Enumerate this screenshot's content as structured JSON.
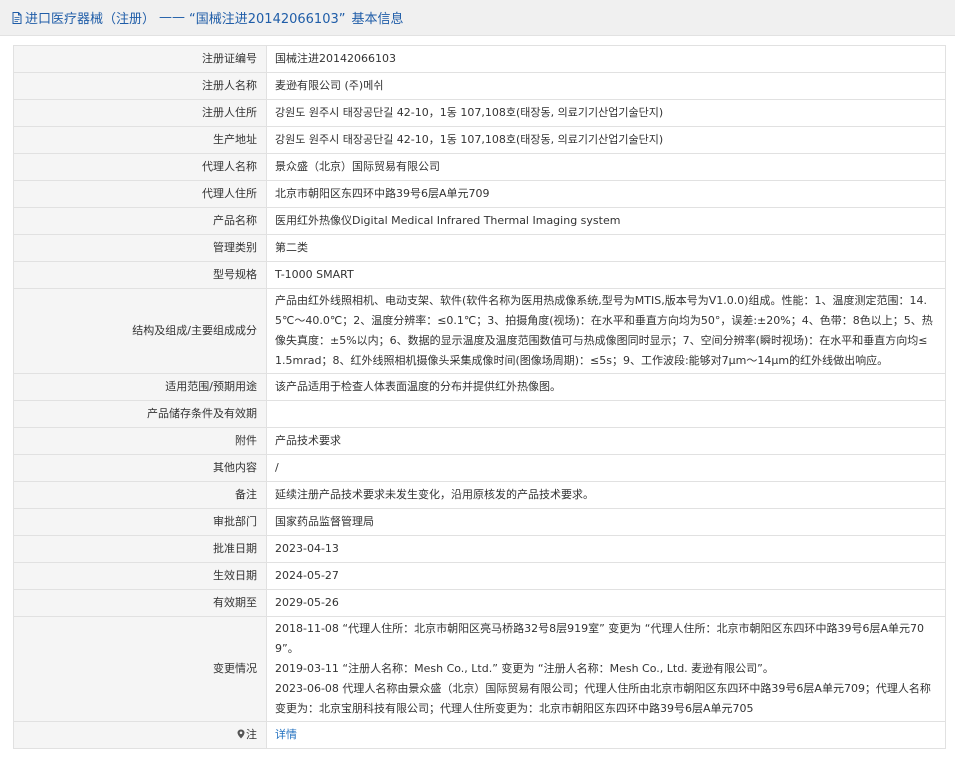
{
  "header": {
    "category": "进口医疗器械（注册）",
    "dash": "——",
    "title": "“国械注进20142066103”",
    "subtitle": "基本信息"
  },
  "rows": [
    {
      "label": "注册证编号",
      "value": "国械注进20142066103"
    },
    {
      "label": "注册人名称",
      "value": "麦逊有限公司 (주)메쉬"
    },
    {
      "label": "注册人住所",
      "value": "강원도 원주시 태장공단길 42-10，1동 107,108호(태장동, 의료기기산업기술단지)"
    },
    {
      "label": "生产地址",
      "value": "강원도 원주시 태장공단길 42-10，1동 107,108호(태장동, 의료기기산업기술단지)"
    },
    {
      "label": "代理人名称",
      "value": "景众盛（北京）国际贸易有限公司"
    },
    {
      "label": "代理人住所",
      "value": "北京市朝阳区东四环中路39号6层A单元709"
    },
    {
      "label": "产品名称",
      "value": "医用红外热像仪Digital Medical Infrared Thermal Imaging system"
    },
    {
      "label": "管理类别",
      "value": "第二类"
    },
    {
      "label": "型号规格",
      "value": "T-1000 SMART"
    },
    {
      "label": "结构及组成/主要组成成分",
      "value": "产品由红外线照相机、电动支架、软件(软件名称为医用热成像系统,型号为MTIS,版本号为V1.0.0)组成。性能：1、温度测定范围：14.5℃～40.0℃；2、温度分辨率：≤0.1℃；3、拍摄角度(视场)：在水平和垂直方向均为50°，误差:±20%；4、色带：8色以上；5、热像失真度：±5%以内；6、数据的显示温度及温度范围数值可与热成像图同时显示；7、空间分辨率(瞬时视场)：在水平和垂直方向均≤1.5mrad；8、红外线照相机摄像头采集成像时间(图像场周期)：≤5s；9、工作波段:能够对7μm～14μm的红外线做出响应。"
    },
    {
      "label": "适用范围/预期用途",
      "value": "该产品适用于检查人体表面温度的分布并提供红外热像图。"
    },
    {
      "label": "产品储存条件及有效期",
      "value": ""
    },
    {
      "label": "附件",
      "value": "产品技术要求"
    },
    {
      "label": "其他内容",
      "value": "/"
    },
    {
      "label": "备注",
      "value": "延续注册产品技术要求未发生变化，沿用原核发的产品技术要求。"
    },
    {
      "label": "审批部门",
      "value": "国家药品监督管理局"
    },
    {
      "label": "批准日期",
      "value": "2023-04-13"
    },
    {
      "label": "生效日期",
      "value": "2024-05-27"
    },
    {
      "label": "有效期至",
      "value": "2029-05-26"
    }
  ],
  "changes": {
    "label": "变更情况",
    "lines": [
      "2018-11-08 “代理人住所：北京市朝阳区亮马桥路32号8层919室” 变更为 “代理人住所：北京市朝阳区东四环中路39号6层A单元709”。",
      "2019-03-11 “注册人名称：Mesh Co., Ltd.” 变更为 “注册人名称：Mesh Co., Ltd. 麦逊有限公司”。",
      "2023-06-08 代理人名称由景众盛（北京）国际贸易有限公司；代理人住所由北京市朝阳区东四环中路39号6层A单元709；代理人名称变更为：北京宝朋科技有限公司；代理人住所变更为：北京市朝阳区东四环中路39号6层A单元705"
    ]
  },
  "note": {
    "label": "注",
    "link": "详情"
  }
}
